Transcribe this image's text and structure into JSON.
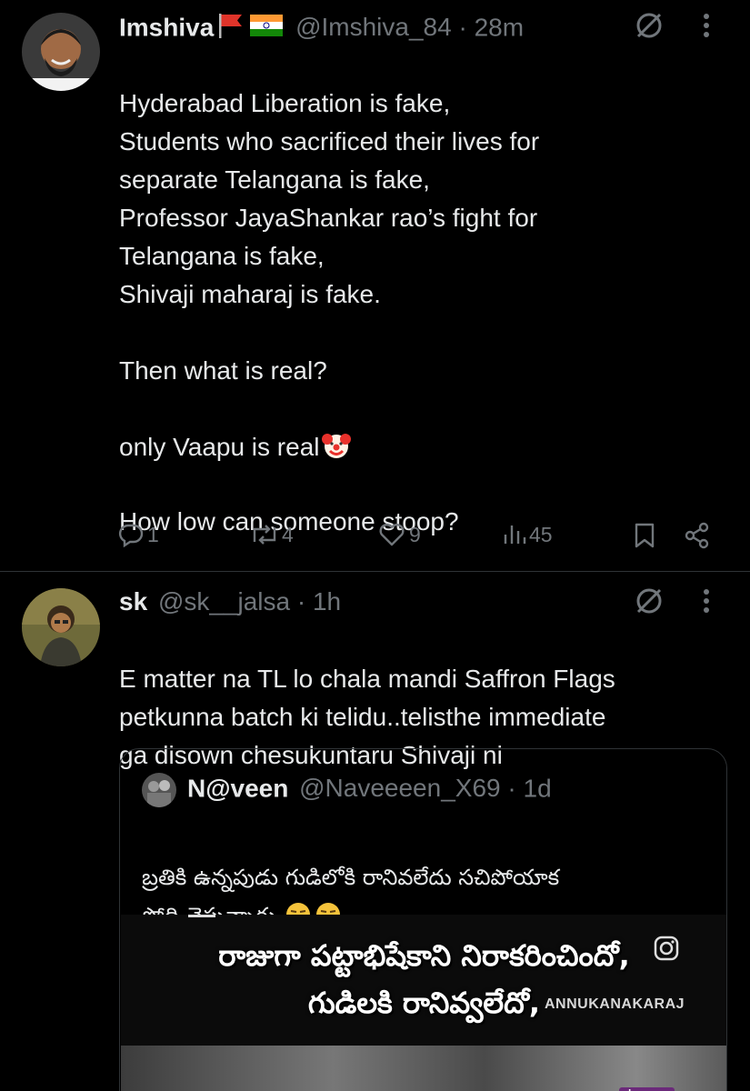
{
  "tweet1": {
    "display_name": "Imshiva",
    "handle": "@Imshiva_84",
    "time": "28m",
    "separator": "·",
    "body": "Hyderabad Liberation is fake,\nStudents who sacrificed their lives for\nseparate Telangana is fake,\nProfessor JayaShankar rao’s fight for\nTelangana is fake,\nShivaji maharaj is fake.\n\nThen what is real?\n\nonly Vaapu is real",
    "body_tail": "How low can someone stoop?",
    "reply_count": "1",
    "retweet_count": "4",
    "like_count": "9",
    "view_count": "45"
  },
  "tweet2": {
    "display_name": "sk",
    "handle": "@sk__jalsa",
    "time": "1h",
    "separator": "·",
    "body": "E matter na TL lo chala mandi  Saffron Flags\npetkunna batch ki telidu..telisthe immediate\nga disown chesukuntaru Shivaji ni"
  },
  "quote": {
    "display_name": "N@veen",
    "handle": "@Naveeeen_X69",
    "time": "1d",
    "separator": "·",
    "body": "బ్రతికి ఉన్నపుడు గుడిలోకి రానివలేదు సచిపోయాక\nసోది చెప్తున్నారు",
    "media_line1": "రాజుగా పట్టాభిషేకాని నిరాకరించిందో,",
    "media_line2": "గుడిలకి రానివ్వలేదో,",
    "watermark": "ANNUKANAKARAJ",
    "media_logo": "shemaroo"
  },
  "colors": {
    "background": "#000000",
    "text": "#e7e9ea",
    "muted": "#71767b",
    "divider": "#2f3336"
  }
}
